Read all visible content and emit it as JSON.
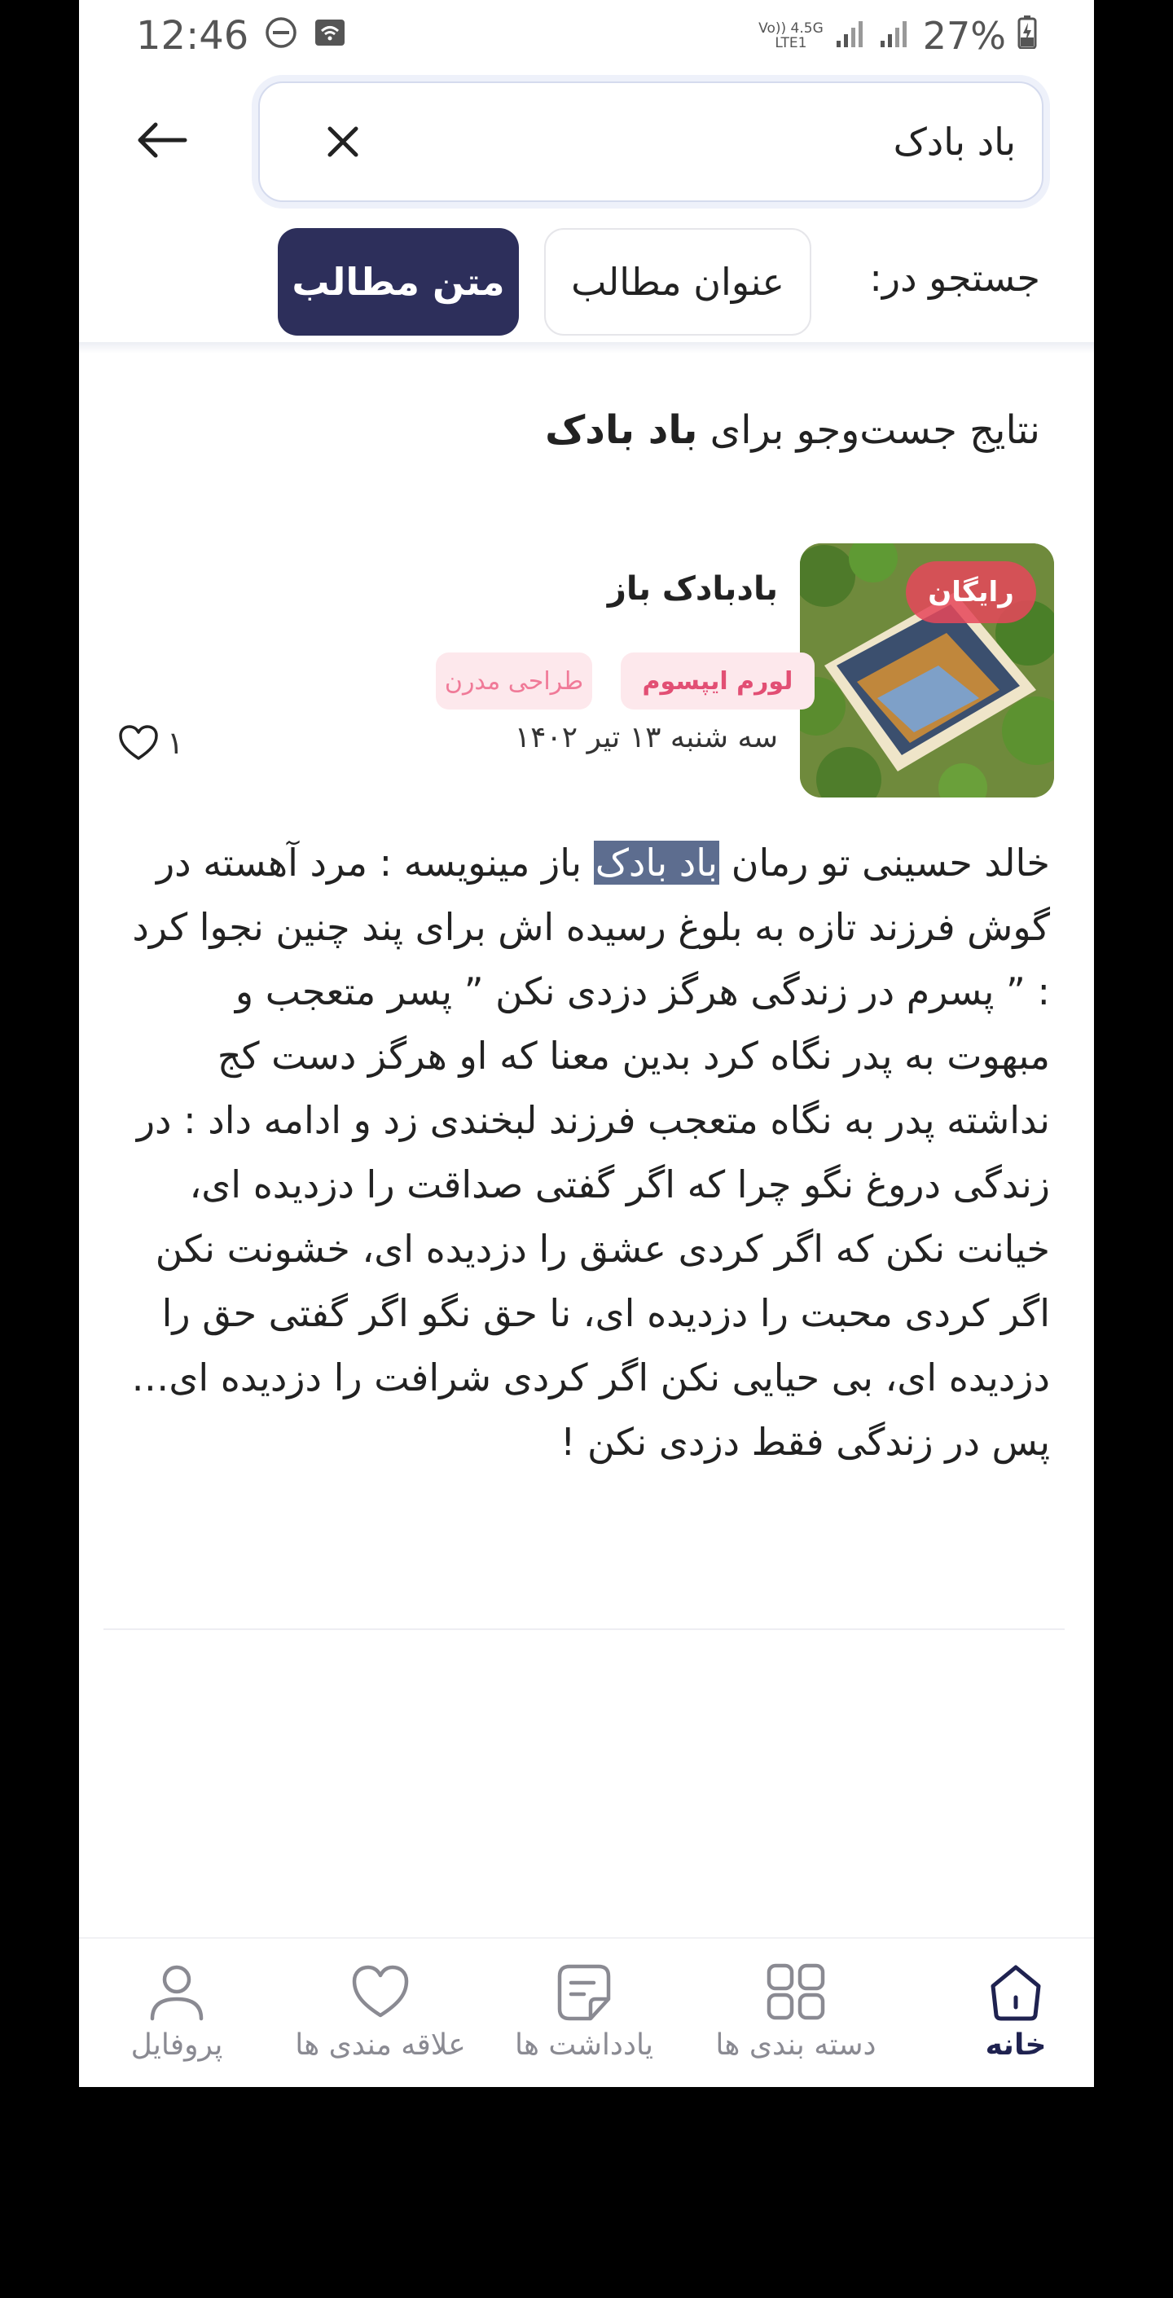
{
  "status_bar": {
    "time": "12:46",
    "network_top": "Vo)) 4.5G",
    "network_bottom": "LTE1",
    "battery": "27%"
  },
  "search": {
    "value": "باد بادک",
    "placeholder": ""
  },
  "filter": {
    "label": "جستجو در:",
    "options": [
      "عنوان مطالب",
      "متن مطالب"
    ],
    "selected": "متن مطالب"
  },
  "results": {
    "heading_prefix": "نتایج جست‌وجو برای",
    "heading_query": "باد بادک"
  },
  "card": {
    "badge": "رایگان",
    "title": "بادبادک باز",
    "tags": [
      "لورم ایپسوم",
      "طراحی مدرن"
    ],
    "date": "سه شنبه ۱۳ تیر ۱۴۰۲",
    "likes": "۱",
    "excerpt_before": "خالد حسینی تو رمان ",
    "excerpt_highlight": "باد بادک",
    "excerpt_after": " باز مینویسه : مرد آهسته در گوش فرزند تازه به بلوغ رسیده اش برای پند چنین نجوا کرد : ” پسرم در زندگی هرگز دزدی نکن ” پسر متعجب و مبهوت به پدر نگاه کرد بدین معنا که او هرگز دست کج نداشته پدر به نگاه متعجب فرزند لبخندی زد و ادامه داد : در زندگی دروغ نگو چرا که اگر گفتی صداقت را دزدیده ای، خیانت نکن که اگر کردی عشق را دزدیده ای، خشونت نکن اگر کردی محبت را دزدیده ای، نا حق نگو اگر گفتی حق را دزدیده ای، بی حیایی نکن اگر کردی شرافت را دزدیده ای… پس در زندگی فقط دزدی نکن !"
  },
  "nav": {
    "home": "خانه",
    "categories": "دسته بندی ها",
    "notes": "یادداشت ها",
    "favorites": "علاقه مندی ها",
    "profile": "پروفایل",
    "active": "home"
  },
  "colors": {
    "primary": "#2d2f5b",
    "tag_bg": "#fde8ec",
    "tag_text": "#e24f74",
    "highlight": "#5d6d8f"
  }
}
